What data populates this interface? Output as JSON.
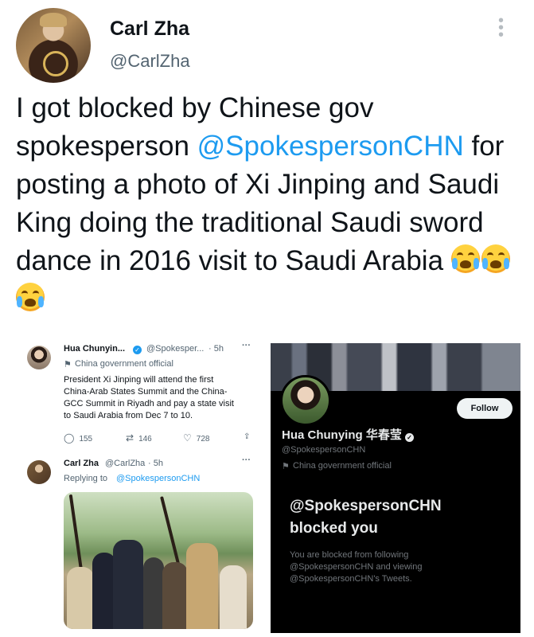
{
  "tweet": {
    "author_name": "Carl Zha",
    "author_handle": "@CarlZha",
    "text_before": "I got blocked by Chinese gov spokesperson ",
    "mention": "@SpokespersonCHN",
    "text_after": " for posting a photo of Xi Jinping and Saudi King doing the traditional Saudi sword dance in 2016 visit to Saudi Arabia ",
    "emoji_icon": "loudly-crying-face-icon"
  },
  "embedded_tweet": {
    "author_name": "Hua Chunyin...",
    "author_handle": "@Spokesper...",
    "time": "· 5h",
    "label": "China government official",
    "body": [
      "President Xi Jinping will attend the first",
      "China-Arab States Summit and the China-",
      "GCC Summit in Riyadh and pay a state visit",
      "to Saudi Arabia from Dec 7 to 10."
    ],
    "replies": "155",
    "retweets": "146",
    "likes": "728"
  },
  "reply_tweet": {
    "author_name": "Carl Zha",
    "author_handle": "@CarlZha",
    "time": "· 5h",
    "replying_prefix": "Replying to ",
    "replying_to": "@SpokespersonCHN"
  },
  "profile": {
    "follow_label": "Follow",
    "name": "Hua Chunying 华春莹",
    "handle": "@SpokespersonCHN",
    "label": "China government official",
    "blocked_line1": "@SpokespersonCHN",
    "blocked_line2": "blocked you",
    "blocked_desc": [
      "You are blocked from following",
      "@SpokespersonCHN and viewing",
      "@SpokespersonCHN's Tweets."
    ]
  },
  "colors": {
    "link": "#1d9bf0",
    "text": "#0f1419",
    "muted": "#536471",
    "dark_bg": "#000000"
  }
}
